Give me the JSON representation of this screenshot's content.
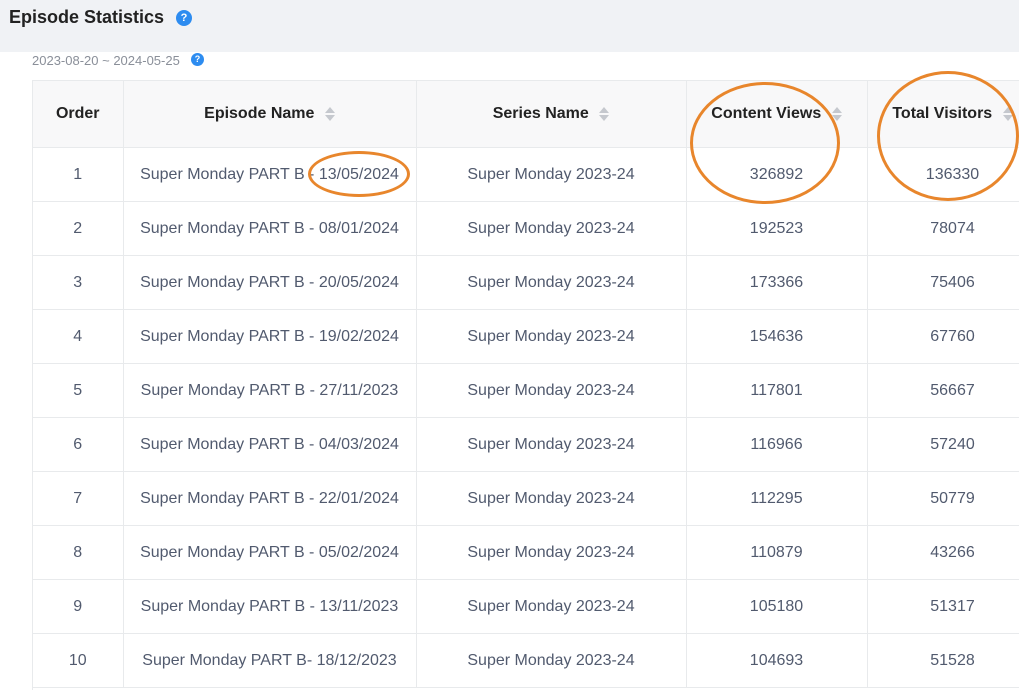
{
  "header": {
    "title": "Episode Statistics",
    "help_glyph": "?"
  },
  "date_range": {
    "text": "2023-08-20 ~ 2024-05-25",
    "help_glyph": "?"
  },
  "table": {
    "columns": [
      {
        "label": "Order",
        "sortable": false
      },
      {
        "label": "Episode Name",
        "sortable": true
      },
      {
        "label": "Series Name",
        "sortable": true
      },
      {
        "label": "Content Views",
        "sortable": true
      },
      {
        "label": "Total Visitors",
        "sortable": true
      }
    ],
    "rows": [
      {
        "order": "1",
        "episode": "Super Monday PART B - 13/05/2024",
        "series": "Super Monday 2023-24",
        "views": "326892",
        "visitors": "136330"
      },
      {
        "order": "2",
        "episode": "Super Monday PART B - 08/01/2024",
        "series": "Super Monday 2023-24",
        "views": "192523",
        "visitors": "78074"
      },
      {
        "order": "3",
        "episode": "Super Monday PART B - 20/05/2024",
        "series": "Super Monday 2023-24",
        "views": "173366",
        "visitors": "75406"
      },
      {
        "order": "4",
        "episode": "Super Monday PART B - 19/02/2024",
        "series": "Super Monday 2023-24",
        "views": "154636",
        "visitors": "67760"
      },
      {
        "order": "5",
        "episode": "Super Monday PART B - 27/11/2023",
        "series": "Super Monday 2023-24",
        "views": "117801",
        "visitors": "56667"
      },
      {
        "order": "6",
        "episode": "Super Monday PART B - 04/03/2024",
        "series": "Super Monday 2023-24",
        "views": "116966",
        "visitors": "57240"
      },
      {
        "order": "7",
        "episode": "Super Monday PART B - 22/01/2024",
        "series": "Super Monday 2023-24",
        "views": "112295",
        "visitors": "50779"
      },
      {
        "order": "8",
        "episode": "Super Monday PART B - 05/02/2024",
        "series": "Super Monday 2023-24",
        "views": "110879",
        "visitors": "43266"
      },
      {
        "order": "9",
        "episode": "Super Monday PART B - 13/11/2023",
        "series": "Super Monday 2023-24",
        "views": "105180",
        "visitors": "51317"
      },
      {
        "order": "10",
        "episode": "Super Monday PART B- 18/12/2023",
        "series": "Super Monday 2023-24",
        "views": "104693",
        "visitors": "51528"
      }
    ]
  },
  "colors": {
    "accent_blue": "#2d8cf0",
    "annotation_orange": "#e8862c",
    "header_bg": "#f0f2f5",
    "table_header_bg": "#f8f8f9",
    "border": "#e8eaec"
  },
  "icons": {
    "help": "question-circle-icon",
    "sort": "sort-caret-icon"
  }
}
